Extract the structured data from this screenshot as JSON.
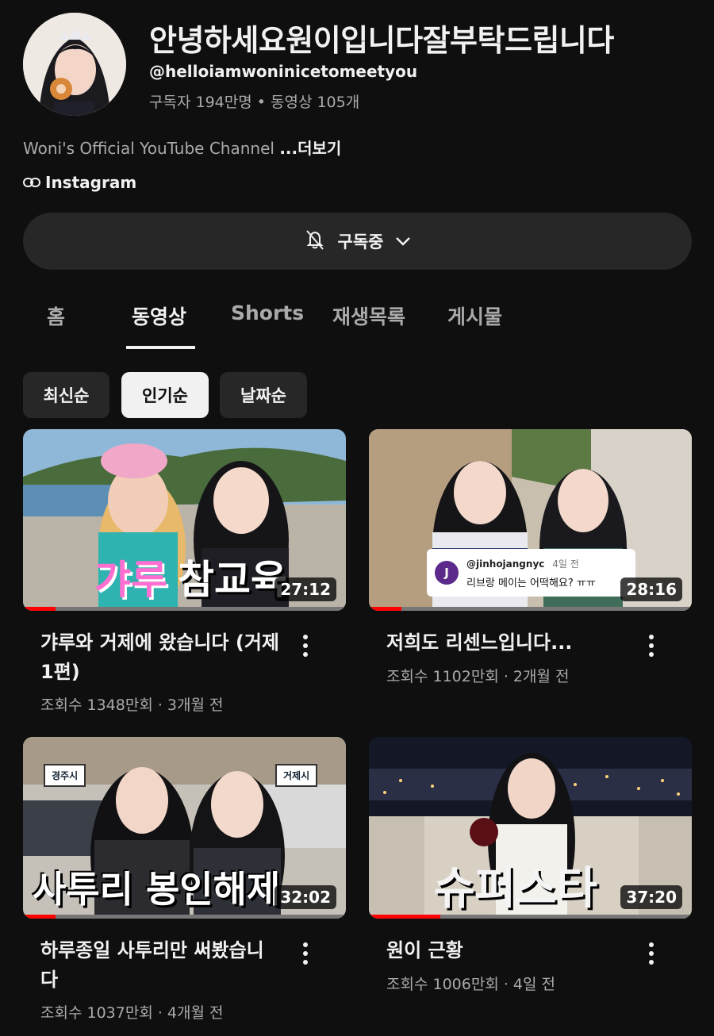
{
  "channel": {
    "name": "안녕하세요원이입니다잘부탁드립니다",
    "handle": "@helloiamwoninicetomeetyou",
    "stats": "구독자 194만명 • 동영상 105개",
    "description": "Woni's Official YouTube Channel",
    "more_label": "...더보기",
    "link_label": "Instagram",
    "subscribe_label": "구독중"
  },
  "tabs": [
    "홈",
    "동영상",
    "Shorts",
    "재생목록",
    "게시물"
  ],
  "active_tab": "동영상",
  "chips": [
    "최신순",
    "인기순",
    "날짜순"
  ],
  "selected_chip": "인기순",
  "videos": [
    {
      "title": "갸루와 거제에 왔습니다 (거제 1편)",
      "meta": "조회수 1348만회 · 3개월 전",
      "duration": "27:12",
      "overlay_a": "갸루",
      "overlay_b": "참교육",
      "progress": 0.1
    },
    {
      "title": "저희도 리센느입니다...",
      "meta": "조회수 1102만회 · 2개월 전",
      "duration": "28:16",
      "comment_user": "@jinhojangnyc",
      "comment_time": "4일 전",
      "comment_text": "리브랑 메이는 어떡해요? ㅠㅠ",
      "comment_avatar": "J",
      "progress": 0.1
    },
    {
      "title": "하루종일 사투리만 써봤습니다",
      "meta": "조회수 1037만회 · 4개월 전",
      "duration": "32:02",
      "overlay": "사투리 봉인해제",
      "sign_left": "경주시",
      "sign_right": "거제시",
      "progress": 0.1
    },
    {
      "title": "원이 근황",
      "meta": "조회수 1006만회 · 4일 전",
      "duration": "37:20",
      "overlay": "슈퍼스타",
      "progress": 0.22
    }
  ]
}
